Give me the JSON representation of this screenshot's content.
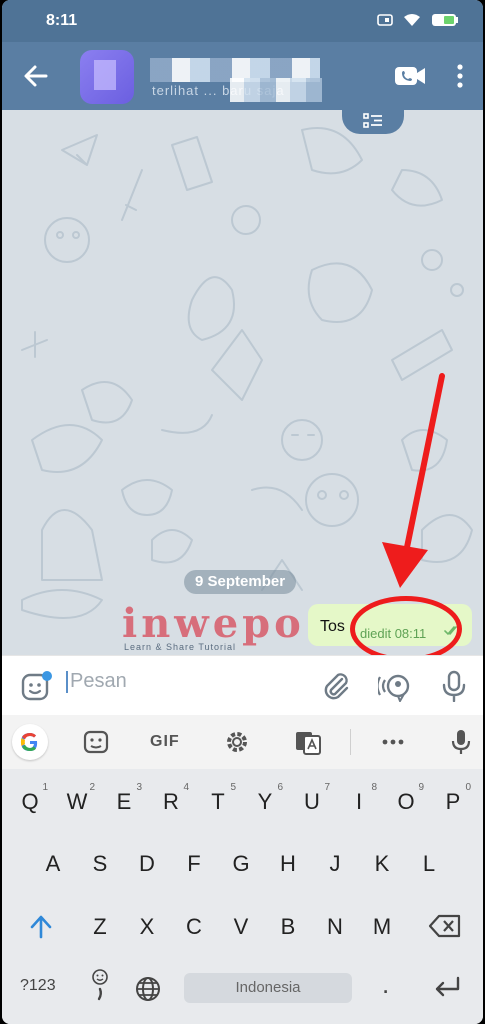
{
  "status_bar": {
    "time": "8:11"
  },
  "header": {
    "subtitle": "terlihat ... baru saja"
  },
  "chat": {
    "date_separator": "9 September",
    "message": {
      "text": "Tos",
      "edited_label": "diedit",
      "time": "08:11"
    }
  },
  "watermark": {
    "brand": "inwepo",
    "tagline": "Learn & Share Tutorial"
  },
  "composer": {
    "placeholder": "Pesan"
  },
  "keyboard": {
    "toolbar": {
      "gif_label": "GIF"
    },
    "rows": [
      {
        "keys": [
          "Q",
          "W",
          "E",
          "R",
          "T",
          "Y",
          "U",
          "I",
          "O",
          "P"
        ],
        "hints": [
          "1",
          "2",
          "3",
          "4",
          "5",
          "6",
          "7",
          "8",
          "9",
          "0"
        ]
      },
      {
        "keys": [
          "A",
          "S",
          "D",
          "F",
          "G",
          "H",
          "J",
          "K",
          "L"
        ]
      },
      {
        "keys": [
          "Z",
          "X",
          "C",
          "V",
          "B",
          "N",
          "M"
        ]
      }
    ],
    "symbols_label": "?123",
    "spacebar_label": "Indonesia",
    "dot_label": "."
  },
  "colors": {
    "header": "#5a7ea3",
    "status_bar": "#4f7396",
    "bubble": "#e5f8c8",
    "annotation": "#ee1c1c",
    "watermark": "#d75a69"
  },
  "icons": [
    "back-arrow-icon",
    "video-call-icon",
    "more-vert-icon",
    "pinned-message-icon",
    "double-check-icon",
    "sticker-icon",
    "attach-icon",
    "voice-translate-icon",
    "mic-icon",
    "google-icon",
    "emoji-card-icon",
    "gear-icon",
    "translate-icon",
    "more-horiz-icon",
    "shift-icon",
    "backspace-icon",
    "emoji-icon",
    "globe-icon",
    "enter-icon"
  ]
}
